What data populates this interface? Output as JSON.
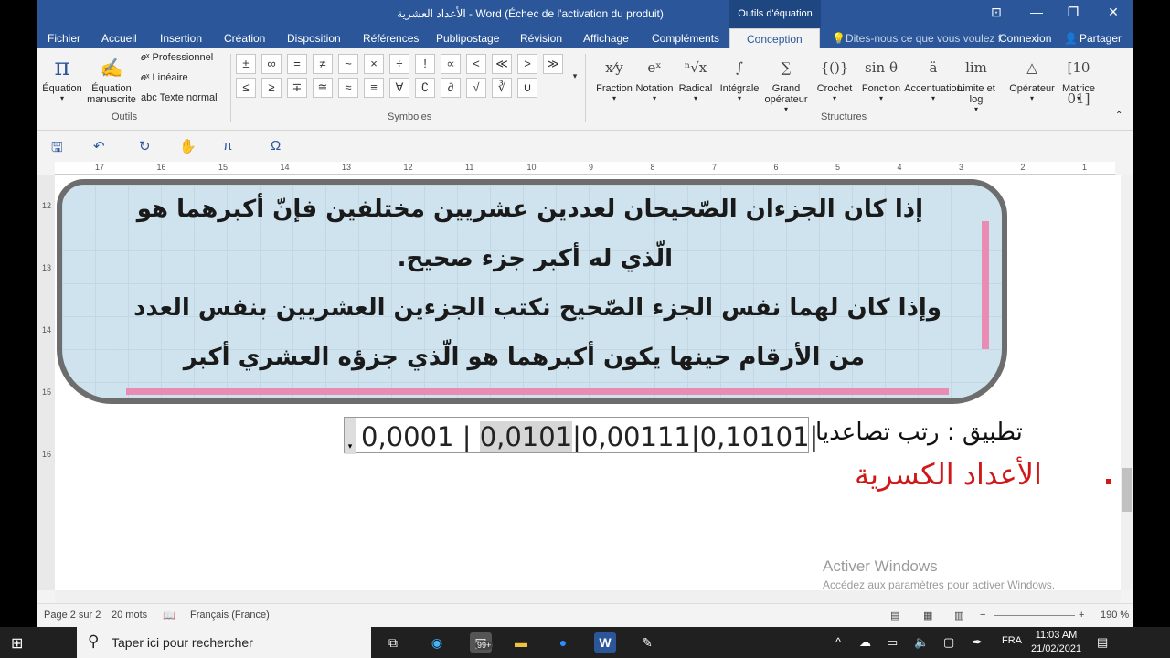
{
  "title_bar": {
    "title": "الأعداد العشرية - Word (Échec de l'activation du produit)",
    "context_tab": "Outils d'équation",
    "buttons": [
      "⊡",
      "—",
      "❐",
      "✕"
    ]
  },
  "tabs": [
    {
      "label": "Fichier",
      "active": false
    },
    {
      "label": "Accueil",
      "active": false
    },
    {
      "label": "Insertion",
      "active": false
    },
    {
      "label": "Création",
      "active": false
    },
    {
      "label": "Disposition",
      "active": false
    },
    {
      "label": "Références",
      "active": false
    },
    {
      "label": "Publipostage",
      "active": false
    },
    {
      "label": "Révision",
      "active": false
    },
    {
      "label": "Affichage",
      "active": false
    },
    {
      "label": "Compléments",
      "active": false
    },
    {
      "label": "Conception",
      "active": true
    }
  ],
  "tell_me": "Dites-nous ce que vous voulez f",
  "account": {
    "connexion": "Connexion",
    "share": "Partager"
  },
  "ribbon": {
    "tools": {
      "equation": "Équation",
      "ink_equation_1": "Équation",
      "ink_equation_2": "manuscrite",
      "professional": "Professionnel",
      "linear": "Linéaire",
      "normal_text": "Texte normal",
      "group": "Outils"
    },
    "symbols": {
      "row1": [
        "±",
        "∞",
        "=",
        "≠",
        "~",
        "×",
        "÷",
        "!",
        "∝",
        "<",
        "≪",
        ">",
        "≫"
      ],
      "row2": [
        "≤",
        "≥",
        "∓",
        "≅",
        "≈",
        "≡",
        "∀",
        "∁",
        "∂",
        "√",
        "∛",
        "∪"
      ],
      "group": "Symboles"
    },
    "structures": {
      "items": [
        {
          "icon": "x⁄y",
          "label": "Fraction"
        },
        {
          "icon": "eˣ",
          "label": "Notation"
        },
        {
          "icon": "ⁿ√x",
          "label": "Radical"
        },
        {
          "icon": "∫",
          "label": "Intégrale"
        },
        {
          "icon": "∑",
          "label": "Grand",
          "label2": "opérateur"
        },
        {
          "icon": "{()}",
          "label": "Crochet"
        },
        {
          "icon": "sin θ",
          "label": "Fonction"
        },
        {
          "icon": "ä",
          "label": "Accentuation"
        },
        {
          "icon": "lim",
          "label": "Limite et",
          "label2": "log"
        },
        {
          "icon": "△",
          "label": "Opérateur"
        },
        {
          "icon": "[10 01]",
          "label": "Matrice"
        }
      ],
      "group": "Structures"
    }
  },
  "qat": {
    "save": "🖫",
    "undo": "↶",
    "redo": "↻",
    "touch": "✋",
    "pi": "π",
    "omega": "Ω"
  },
  "ruler": {
    "h": [
      "17",
      "16",
      "15",
      "14",
      "13",
      "12",
      "11",
      "10",
      "9",
      "8",
      "7",
      "6",
      "5",
      "4",
      "3",
      "2",
      "1"
    ],
    "v": [
      "12",
      "13",
      "14",
      "15",
      "16"
    ]
  },
  "document": {
    "rule_lines": [
      "إذا كان الجزءان الصّحيحان لعددين عشريين مختلفين فإنّ أكبرهما هو",
      "الّذي له أكبر جزء صحيح.",
      "وإذا كان لهما نفس الجزء الصّحيح نكتب الجزءين العشريين بنفس العدد",
      "من الأرقام حينها يكون أكبرهما هو الّذي جزؤه العشري أكبر"
    ],
    "equation": {
      "part1": "0,0001 | ",
      "highlight": "0,0101",
      "part2": "|0,00111|0,10101|"
    },
    "application": "تطبيق : رتب تصاعديا",
    "red_title": "الأعداد الكسرية"
  },
  "activation": {
    "line1": "Activer Windows",
    "line2": "Accédez aux paramètres pour activer Windows."
  },
  "status": {
    "page": "Page 2 sur 2",
    "words": "20 mots",
    "language": "Français (France)",
    "zoom": "190 %"
  },
  "taskbar": {
    "search": "Taper ici pour rechercher",
    "badge": "99+",
    "lang": "FRA",
    "time": "11:03 AM",
    "date": "21/02/2021"
  }
}
